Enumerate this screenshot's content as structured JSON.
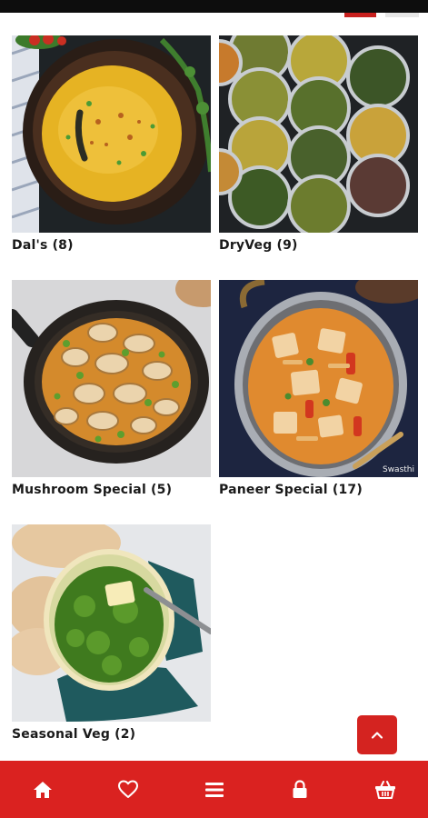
{
  "categories": [
    {
      "name": "Dal's",
      "count": "(8)"
    },
    {
      "name": "DryVeg",
      "count": "(9)"
    },
    {
      "name": "Mushroom Special",
      "count": "(5)"
    },
    {
      "name": "Paneer Special",
      "count": "(17)"
    },
    {
      "name": "Seasonal Veg",
      "count": "(2)"
    }
  ],
  "image_watermarks": {
    "paneer": "Swasthi"
  },
  "colors": {
    "accent": "#da2220",
    "scroll_button": "#d42320",
    "text": "#1a1a1a"
  },
  "icons": {
    "scroll_top": "chevron-up-icon",
    "nav": [
      "home-icon",
      "heart-icon",
      "menu-icon",
      "lock-icon",
      "basket-icon"
    ]
  }
}
